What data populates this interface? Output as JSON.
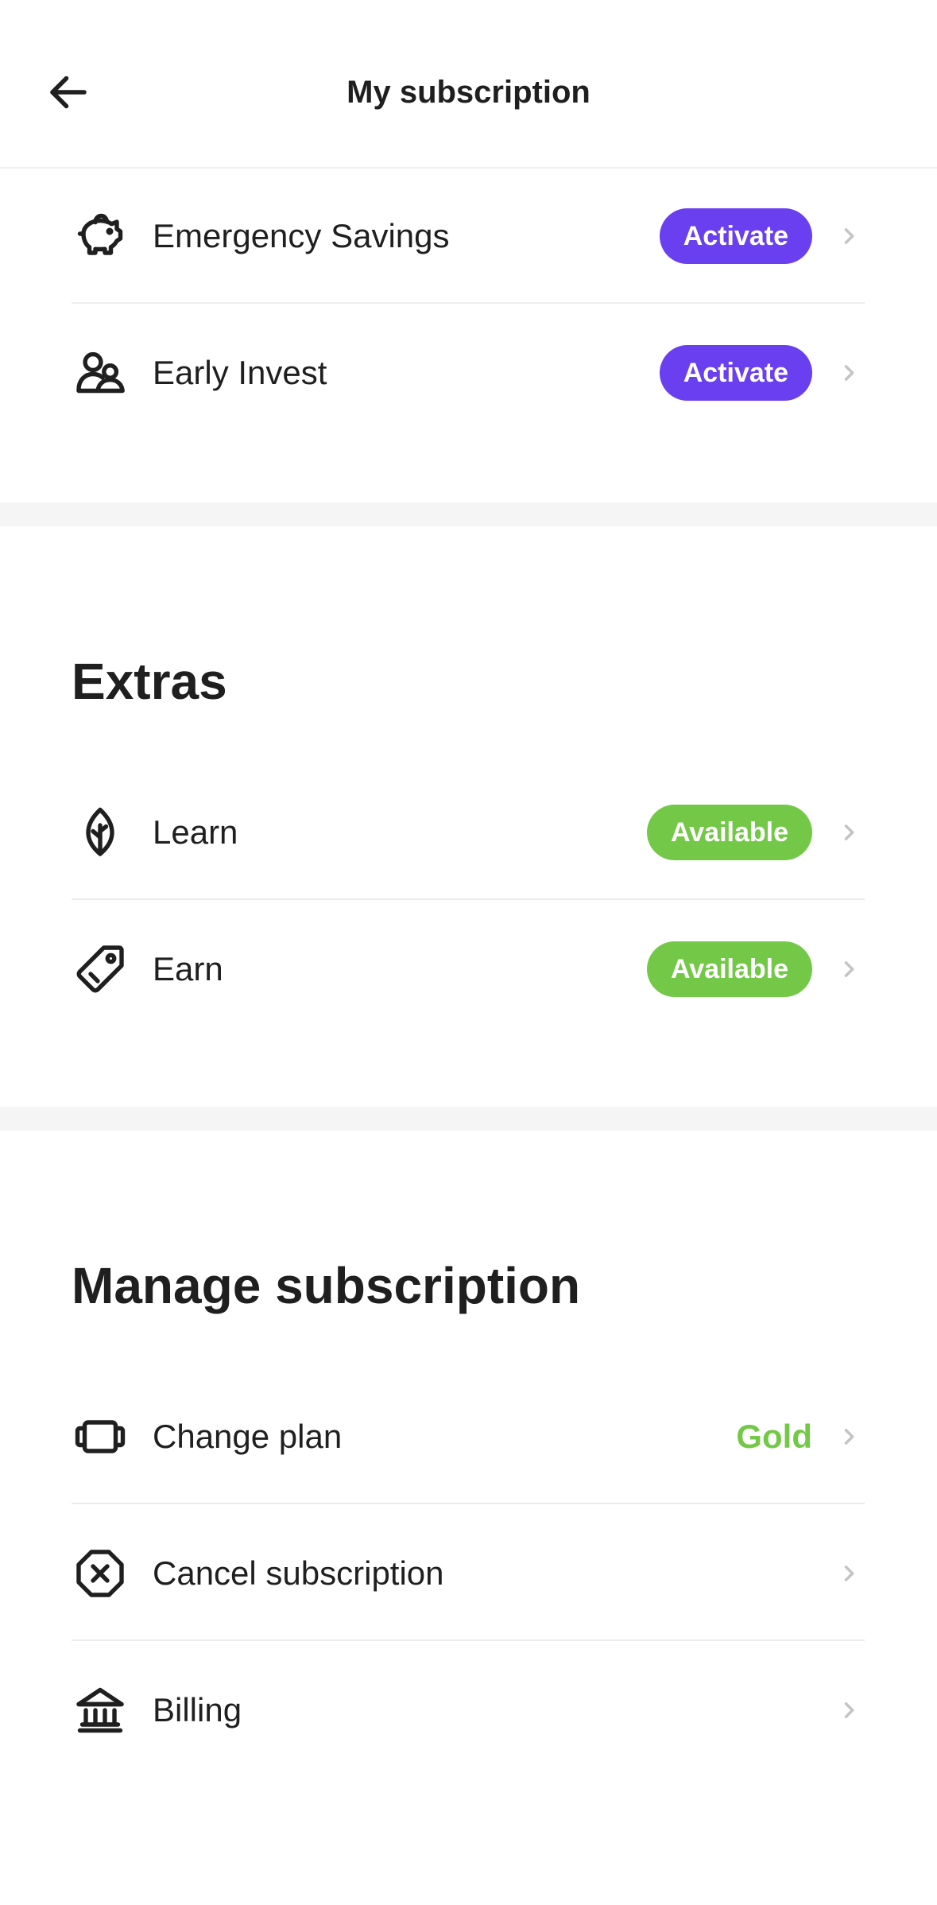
{
  "header": {
    "title": "My subscription",
    "back_icon": "arrow-left-icon"
  },
  "features": {
    "items": [
      {
        "icon": "piggy-bank-icon",
        "label": "Emergency Savings",
        "badge": "Activate"
      },
      {
        "icon": "people-icon",
        "label": "Early Invest",
        "badge": "Activate"
      }
    ]
  },
  "extras": {
    "title": "Extras",
    "items": [
      {
        "icon": "leaf-icon",
        "label": "Learn",
        "badge": "Available"
      },
      {
        "icon": "tag-icon",
        "label": "Earn",
        "badge": "Available"
      }
    ]
  },
  "manage": {
    "title": "Manage subscription",
    "items": [
      {
        "icon": "card-icon",
        "label": "Change plan",
        "value": "Gold"
      },
      {
        "icon": "cancel-circle-icon",
        "label": "Cancel subscription"
      },
      {
        "icon": "bank-icon",
        "label": "Billing"
      }
    ]
  },
  "colors": {
    "activate_badge": "#6a3ff0",
    "available_badge": "#74c848",
    "plan_value": "#74c848",
    "chevron": "#c4c4c4"
  }
}
